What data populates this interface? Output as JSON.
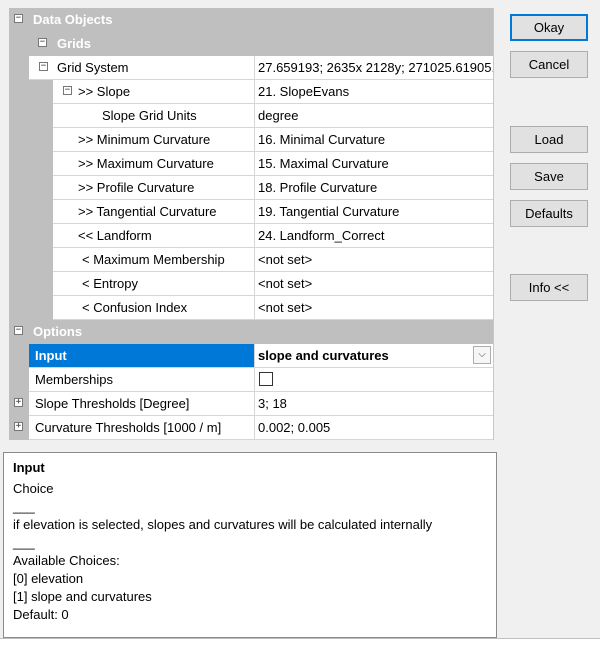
{
  "properties": {
    "data_objects": "Data Objects",
    "grids": "Grids",
    "grid_system": {
      "name": "Grid System",
      "value": "27.659193; 2635x 2128y; 271025.61905..."
    },
    "slope": {
      "name": ">> Slope",
      "value": "21. SlopeEvans"
    },
    "slope_units": {
      "name": "Slope Grid Units",
      "value": "degree"
    },
    "min_curv": {
      "name": ">> Minimum Curvature",
      "value": "16. Minimal Curvature"
    },
    "max_curv": {
      "name": ">> Maximum Curvature",
      "value": "15. Maximal Curvature"
    },
    "prof_curv": {
      "name": ">> Profile Curvature",
      "value": "18. Profile Curvature"
    },
    "tang_curv": {
      "name": ">> Tangential Curvature",
      "value": "19. Tangential Curvature"
    },
    "landform": {
      "name": "<< Landform",
      "value": "24. Landform_Correct"
    },
    "max_member": {
      "name": "< Maximum Membership",
      "value": "<not set>"
    },
    "entropy": {
      "name": "< Entropy",
      "value": "<not set>"
    },
    "confusion": {
      "name": "< Confusion Index",
      "value": "<not set>"
    },
    "options": "Options",
    "input": {
      "name": "Input",
      "value": "slope and curvatures"
    },
    "memberships": {
      "name": "Memberships",
      "checked": false
    },
    "slope_thr": {
      "name": "Slope Thresholds [Degree]",
      "value": "3; 18"
    },
    "curv_thr": {
      "name": "Curvature Thresholds [1000 / m]",
      "value": "0.002; 0.005"
    }
  },
  "icons": {
    "expand_minus": "⊟",
    "expand_plus": "⊞",
    "dropdown": "chevron-down-icon"
  },
  "glyphs": {
    "minus": "−",
    "plus": "+",
    "chevron": "⌵"
  },
  "help": {
    "title": "Input",
    "type": "Choice",
    "sep1": "___",
    "description": "if elevation is selected, slopes and curvatures will be calculated internally",
    "sep2": "___",
    "choices_header": "Available Choices:",
    "choice0": "[0] elevation",
    "choice1": "[1] slope and curvatures",
    "default": "Default: 0"
  },
  "buttons": {
    "okay": "Okay",
    "cancel": "Cancel",
    "load": "Load",
    "save": "Save",
    "defaults": "Defaults",
    "info": "Info <<"
  },
  "colors": {
    "selection": "#0078d7",
    "category": "#bfbfbf"
  }
}
